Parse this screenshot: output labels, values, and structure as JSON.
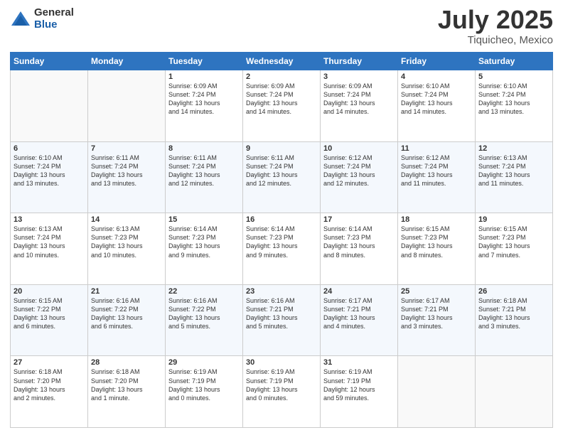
{
  "header": {
    "logo_general": "General",
    "logo_blue": "Blue",
    "title": "July 2025",
    "location": "Tiquicheo, Mexico"
  },
  "weekdays": [
    "Sunday",
    "Monday",
    "Tuesday",
    "Wednesday",
    "Thursday",
    "Friday",
    "Saturday"
  ],
  "weeks": [
    [
      {
        "day": "",
        "info": ""
      },
      {
        "day": "",
        "info": ""
      },
      {
        "day": "1",
        "info": "Sunrise: 6:09 AM\nSunset: 7:24 PM\nDaylight: 13 hours\nand 14 minutes."
      },
      {
        "day": "2",
        "info": "Sunrise: 6:09 AM\nSunset: 7:24 PM\nDaylight: 13 hours\nand 14 minutes."
      },
      {
        "day": "3",
        "info": "Sunrise: 6:09 AM\nSunset: 7:24 PM\nDaylight: 13 hours\nand 14 minutes."
      },
      {
        "day": "4",
        "info": "Sunrise: 6:10 AM\nSunset: 7:24 PM\nDaylight: 13 hours\nand 14 minutes."
      },
      {
        "day": "5",
        "info": "Sunrise: 6:10 AM\nSunset: 7:24 PM\nDaylight: 13 hours\nand 13 minutes."
      }
    ],
    [
      {
        "day": "6",
        "info": "Sunrise: 6:10 AM\nSunset: 7:24 PM\nDaylight: 13 hours\nand 13 minutes."
      },
      {
        "day": "7",
        "info": "Sunrise: 6:11 AM\nSunset: 7:24 PM\nDaylight: 13 hours\nand 13 minutes."
      },
      {
        "day": "8",
        "info": "Sunrise: 6:11 AM\nSunset: 7:24 PM\nDaylight: 13 hours\nand 12 minutes."
      },
      {
        "day": "9",
        "info": "Sunrise: 6:11 AM\nSunset: 7:24 PM\nDaylight: 13 hours\nand 12 minutes."
      },
      {
        "day": "10",
        "info": "Sunrise: 6:12 AM\nSunset: 7:24 PM\nDaylight: 13 hours\nand 12 minutes."
      },
      {
        "day": "11",
        "info": "Sunrise: 6:12 AM\nSunset: 7:24 PM\nDaylight: 13 hours\nand 11 minutes."
      },
      {
        "day": "12",
        "info": "Sunrise: 6:13 AM\nSunset: 7:24 PM\nDaylight: 13 hours\nand 11 minutes."
      }
    ],
    [
      {
        "day": "13",
        "info": "Sunrise: 6:13 AM\nSunset: 7:24 PM\nDaylight: 13 hours\nand 10 minutes."
      },
      {
        "day": "14",
        "info": "Sunrise: 6:13 AM\nSunset: 7:23 PM\nDaylight: 13 hours\nand 10 minutes."
      },
      {
        "day": "15",
        "info": "Sunrise: 6:14 AM\nSunset: 7:23 PM\nDaylight: 13 hours\nand 9 minutes."
      },
      {
        "day": "16",
        "info": "Sunrise: 6:14 AM\nSunset: 7:23 PM\nDaylight: 13 hours\nand 9 minutes."
      },
      {
        "day": "17",
        "info": "Sunrise: 6:14 AM\nSunset: 7:23 PM\nDaylight: 13 hours\nand 8 minutes."
      },
      {
        "day": "18",
        "info": "Sunrise: 6:15 AM\nSunset: 7:23 PM\nDaylight: 13 hours\nand 8 minutes."
      },
      {
        "day": "19",
        "info": "Sunrise: 6:15 AM\nSunset: 7:23 PM\nDaylight: 13 hours\nand 7 minutes."
      }
    ],
    [
      {
        "day": "20",
        "info": "Sunrise: 6:15 AM\nSunset: 7:22 PM\nDaylight: 13 hours\nand 6 minutes."
      },
      {
        "day": "21",
        "info": "Sunrise: 6:16 AM\nSunset: 7:22 PM\nDaylight: 13 hours\nand 6 minutes."
      },
      {
        "day": "22",
        "info": "Sunrise: 6:16 AM\nSunset: 7:22 PM\nDaylight: 13 hours\nand 5 minutes."
      },
      {
        "day": "23",
        "info": "Sunrise: 6:16 AM\nSunset: 7:21 PM\nDaylight: 13 hours\nand 5 minutes."
      },
      {
        "day": "24",
        "info": "Sunrise: 6:17 AM\nSunset: 7:21 PM\nDaylight: 13 hours\nand 4 minutes."
      },
      {
        "day": "25",
        "info": "Sunrise: 6:17 AM\nSunset: 7:21 PM\nDaylight: 13 hours\nand 3 minutes."
      },
      {
        "day": "26",
        "info": "Sunrise: 6:18 AM\nSunset: 7:21 PM\nDaylight: 13 hours\nand 3 minutes."
      }
    ],
    [
      {
        "day": "27",
        "info": "Sunrise: 6:18 AM\nSunset: 7:20 PM\nDaylight: 13 hours\nand 2 minutes."
      },
      {
        "day": "28",
        "info": "Sunrise: 6:18 AM\nSunset: 7:20 PM\nDaylight: 13 hours\nand 1 minute."
      },
      {
        "day": "29",
        "info": "Sunrise: 6:19 AM\nSunset: 7:19 PM\nDaylight: 13 hours\nand 0 minutes."
      },
      {
        "day": "30",
        "info": "Sunrise: 6:19 AM\nSunset: 7:19 PM\nDaylight: 13 hours\nand 0 minutes."
      },
      {
        "day": "31",
        "info": "Sunrise: 6:19 AM\nSunset: 7:19 PM\nDaylight: 12 hours\nand 59 minutes."
      },
      {
        "day": "",
        "info": ""
      },
      {
        "day": "",
        "info": ""
      }
    ]
  ]
}
